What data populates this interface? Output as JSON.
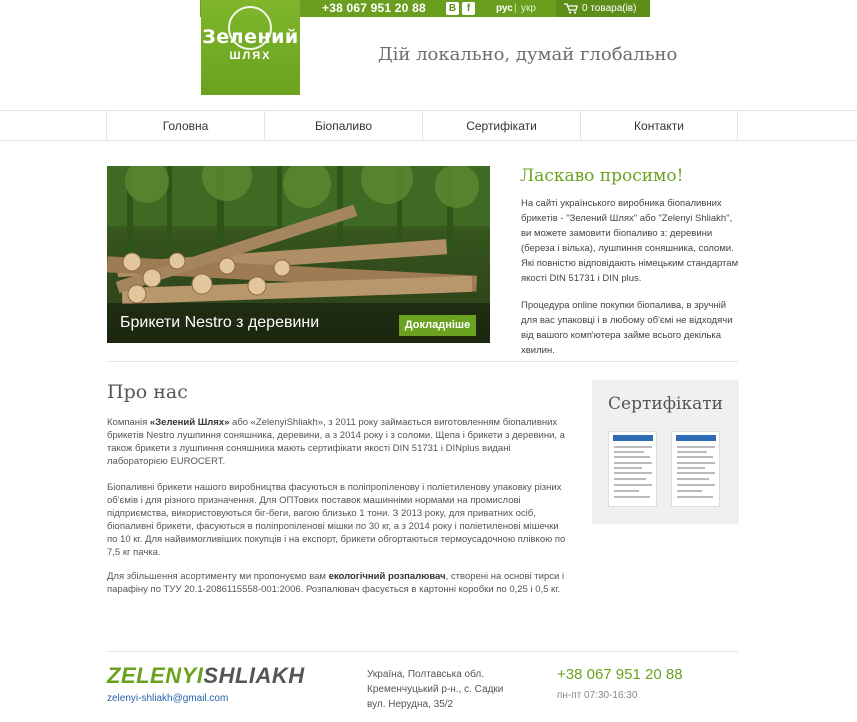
{
  "header": {
    "phone": "+38 067 951 20 88",
    "social": {
      "vk": "В",
      "fb": "f"
    },
    "lang": {
      "ru": "рус",
      "sep": "|",
      "uk": "укр"
    },
    "cart": "0 товара(ів)",
    "logo_title": "Зелений",
    "logo_sub": "ШЛЯХ",
    "slogan": "Дій локально, думай глобально"
  },
  "nav": {
    "items": [
      "Головна",
      "Біопаливо",
      "Сертифікати",
      "Контакти"
    ]
  },
  "hero": {
    "caption": "Брикети Nestro з деревини",
    "button": "Докладніше"
  },
  "welcome": {
    "title": "Ласкаво просимо!",
    "p1": "На сайті українського виробника біопаливних брикетів - \"Зелений Шлях\" або \"Zelenyi Shliakh\", ви можете замовити біопаливо з: деревини (береза і вільха), лушпиння соняшника, соломи. Які повністю відповідають німецьким стандартам якості DIN 51731 і DIN plus.",
    "p2": "Процедура online покупки біопалива, в зручній для вас упаковці і в любому об'ємі не відходячи від вашого комп'ютера займе всього декілька хвилин."
  },
  "about": {
    "title": "Про нас",
    "p1_a": "Компанія ",
    "p1_strong": "«Зелений Шлях»",
    "p1_b": " або «ZelenyiShliakh», з 2011 року займається виготовленням біопаливних брикетів Nestro лушпиння соняшника, деревини, а з 2014 року і з соломи. Щепа і брикети з деревини, а також брикети з лушпиння соняшника мають сертифікати якості DIN 51731 і DINplus видані лабораторією EUROCERT.",
    "p2": "Біопаливні брикети нашого виробництва фасуються в поліпропіленову і поліетиленову упаковку різних об'ємів і для різного призначення. Для ОПТових поставок машинніми нормами на промислові підприємства, використовуються біг-беги, вагою близько 1 тони. З 2013 року, для приватних осіб, біопаливні брикети, фасуються в поліпропіленові мішки по 30 кг, а з 2014 року і поліетиленові мішечки по 10 кг. Для найвимогливіших покупців і на експорт, брикети обгортаються термоусадочною плівкою по 7,5 кг пачка.",
    "p3_a": "Для збільшення асортименту ми пропонуємо вам ",
    "p3_strong": "екологічний розпалювач",
    "p3_b": ", створені на основі тирси і парафіну по ТУУ 20.1-2086115558-001:2006. Розпалювач фасується в картонні коробки по 0,25 і 0,5 кг."
  },
  "certs": {
    "title": "Сертифікати"
  },
  "footer": {
    "logo_a": "ZELENYI",
    "logo_b": "SHLIAKH",
    "email": "zelenyi-shliakh@gmail.com",
    "addr1": "Україна, Полтавська обл.",
    "addr2": "Кременчуцький р-н., с. Садки",
    "addr3": "вул. Нерудна, 35/2",
    "phone": "+38 067 951 20 88",
    "hours": "пн-пт 07:30-16:30"
  },
  "colors": {
    "brand_green": "#6aa21f",
    "link_blue": "#2563a8"
  }
}
